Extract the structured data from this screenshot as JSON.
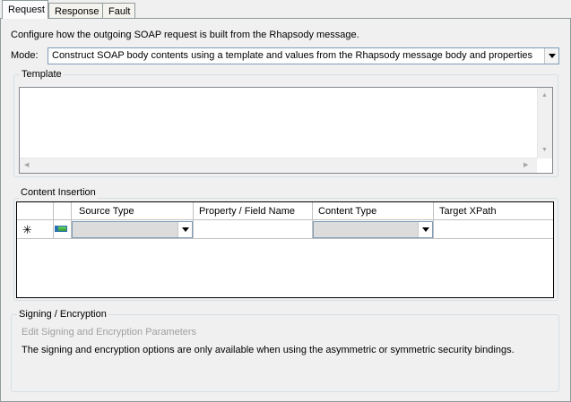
{
  "tabs": [
    {
      "label": "Request"
    },
    {
      "label": "Response"
    },
    {
      "label": "Fault"
    }
  ],
  "description": "Configure how the outgoing SOAP request is built from the Rhapsody message.",
  "mode": {
    "label": "Mode:",
    "selected": "Construct SOAP body contents using a template and values from the Rhapsody message body and properties"
  },
  "template": {
    "legend": "Template",
    "value": ""
  },
  "content_insertion": {
    "legend": "Content Insertion",
    "columns": [
      "Source Type",
      "Property / Field Name",
      "Content Type",
      "Target XPath"
    ],
    "new_row_marker": "✳",
    "row": {
      "source_type": "",
      "property_field_name": "",
      "content_type": "",
      "target_xpath": ""
    }
  },
  "signing": {
    "legend": "Signing / Encryption",
    "link": "Edit Signing and Encryption Parameters",
    "note": "The signing and encryption options are only available when using the asymmetric or symmetric security bindings."
  }
}
